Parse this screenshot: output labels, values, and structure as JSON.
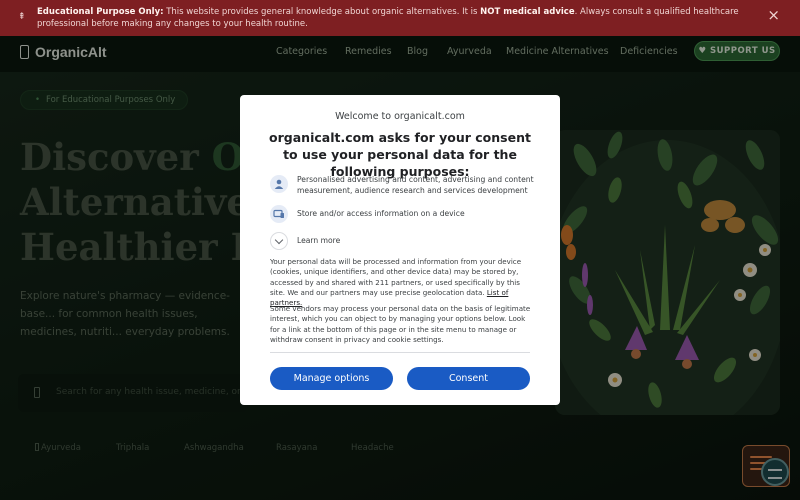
{
  "banner": {
    "lead": "Educational Purpose Only:",
    "text_1": " This website provides general knowledge about organic alternatives. It is ",
    "emphasis": "NOT medical advice",
    "text_2": ". Always consult a qualified healthcare professional before making any changes to your health routine.",
    "close": "×",
    "icon": "info-icon"
  },
  "nav": {
    "logo": "OrganicAlt",
    "items": [
      "Categories",
      "Remedies",
      "Blog",
      "Ayurveda",
      "Medicine Alternatives",
      "Deficiencies"
    ],
    "support": "♥ SUPPORT US"
  },
  "hero": {
    "pill": "For Educational Purposes Only",
    "title_line1_a": "Discover ",
    "title_line1_b": "Org",
    "title_line2": "Alternatives",
    "title_line3": "Healthier Lif",
    "subtitle": "Explore nature's pharmacy — evidence-base... for common health issues, medicines, nutriti... everyday problems.",
    "search_placeholder": "Search for any health issue, medicine, or de",
    "tags": [
      "Ayurveda",
      "Triphala",
      "Ashwagandha",
      "Rasayana",
      "Headache"
    ]
  },
  "consent": {
    "site": "Welcome to organicalt.com",
    "title": "organicalt.com asks for your consent to use your personal data for the following purposes:",
    "purposes": [
      "Personalised advertising and content, advertising and content measurement, audience research and services development",
      "Store and/or access information on a device"
    ],
    "learn_more": "Learn more",
    "paragraph1": "Your personal data will be processed and information from your device (cookies, unique identifiers, and other device data) may be stored by, accessed by and shared with 211 partners, or used specifically by this site. We and our partners may use precise geolocation data. ",
    "partners_link": "List of partners.",
    "paragraph2": "Some vendors may process your personal data on the basis of legitimate interest, which you can object to by managing your options below. Look for a link at the bottom of this page or in the site menu to manage or withdraw consent in privacy and cookie settings.",
    "manage_button": "Manage options",
    "consent_button": "Consent"
  },
  "colors": {
    "banner_bg": "#7e1f22",
    "nav_bg": "#0b170e",
    "accent_green": "#2d6a35",
    "button_blue": "#1a5bc4"
  }
}
